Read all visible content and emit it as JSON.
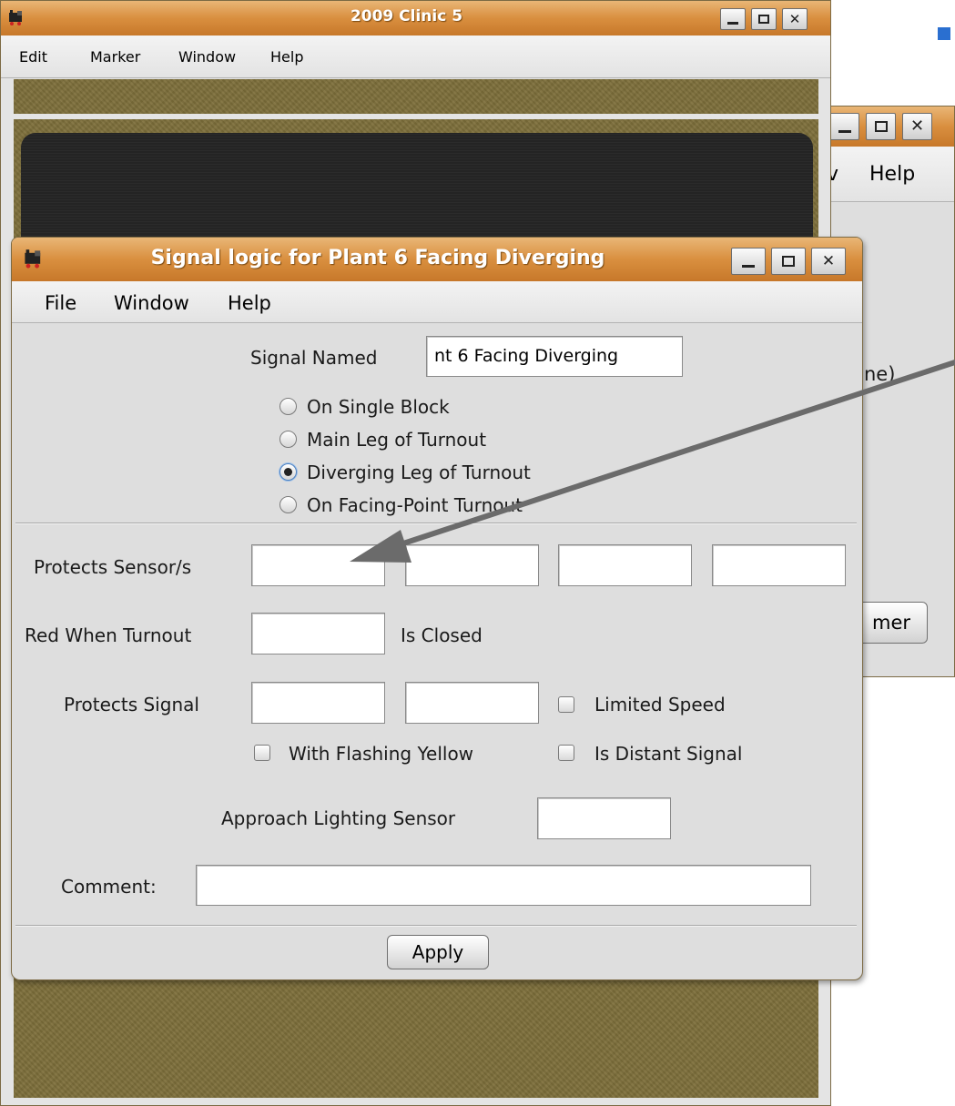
{
  "back_window": {
    "menu_partial": "v",
    "help": "Help",
    "label_partial": "ne)",
    "button_partial": "mer"
  },
  "clinic_window": {
    "title": "2009 Clinic 5",
    "menu": [
      "Edit",
      "Marker",
      "Window",
      "Help"
    ]
  },
  "signal_window": {
    "title": "Signal logic for Plant 6 Facing Diverging",
    "menu": [
      "File",
      "Window",
      "Help"
    ],
    "signal_named_label": "Signal Named",
    "signal_named_value": "nt 6 Facing Diverging",
    "mode_options": [
      {
        "label": "On Single Block",
        "selected": false
      },
      {
        "label": "Main Leg of Turnout",
        "selected": false
      },
      {
        "label": "Diverging Leg of Turnout",
        "selected": true
      },
      {
        "label": "On Facing-Point Turnout",
        "selected": false
      }
    ],
    "protects_sensors_label": "Protects Sensor/s",
    "protects_sensors_values": [
      "",
      "",
      "",
      ""
    ],
    "red_when_turnout_label": "Red When Turnout",
    "red_when_turnout_value": "",
    "is_closed_label": "Is Closed",
    "protects_signal_label": "Protects Signal",
    "protects_signal_values": [
      "",
      ""
    ],
    "limited_speed_label": "Limited Speed",
    "limited_speed_checked": false,
    "flashing_yellow_label": "With Flashing Yellow",
    "flashing_yellow_checked": false,
    "distant_signal_label": "Is Distant Signal",
    "distant_signal_checked": false,
    "approach_lighting_label": "Approach Lighting Sensor",
    "approach_lighting_value": "",
    "comment_label": "Comment:",
    "comment_value": "",
    "apply_label": "Apply"
  },
  "colors": {
    "titlebar": "#d98f3f",
    "panel": "#dedede",
    "layout_background": "#7d6e3a",
    "arrow": "#6b6b6b",
    "accent": "#2a6fd0"
  }
}
